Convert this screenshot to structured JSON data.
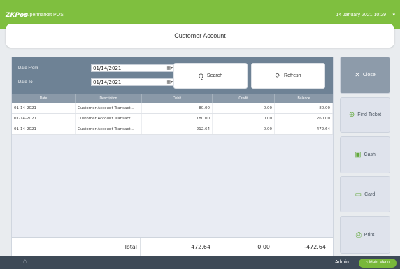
{
  "topbar": {
    "logo": "ZKPos",
    "app_name": "Supermarket POS",
    "datetime": "14 January 2021 10:29",
    "dropdown_glyph": "▾"
  },
  "title": "Customer Account",
  "filters": {
    "date_from_label": "Date From",
    "date_from_value": "01/14/2021",
    "date_to_label": "Date To",
    "date_to_value": "01/14/2021",
    "calendar_glyph": "▦▾"
  },
  "buttons": {
    "search": "Search",
    "search_icon": "Q",
    "refresh": "Refresh",
    "refresh_icon": "⟳"
  },
  "table": {
    "headers": [
      "Date",
      "Description",
      "Debit",
      "Credit",
      "Balance"
    ],
    "rows": [
      [
        "01-14-2021",
        "Customer Account Transact...",
        "80.00",
        "0.00",
        "80.00"
      ],
      [
        "01-14-2021",
        "Customer Account Transact...",
        "180.00",
        "0.00",
        "260.00"
      ],
      [
        "01-14-2021",
        "Customer Account Transact...",
        "212.64",
        "0.00",
        "472.64"
      ]
    ]
  },
  "totals": {
    "label": "Total",
    "debit": "472.64",
    "credit": "0.00",
    "balance": "-472.64"
  },
  "side": {
    "close": "Close",
    "close_icon": "✕",
    "find_ticket": "Find Ticket",
    "find_ticket_icon": "⊕",
    "cash": "Cash",
    "cash_icon": "▣",
    "card": "Card",
    "card_icon": "▭",
    "print": "Print",
    "print_icon": "⎙"
  },
  "bottom": {
    "home_icon": "⌂",
    "user": "Admin",
    "main_menu": "Main Menu",
    "main_menu_icon": "⌂"
  },
  "colors": {
    "topbar": "#7fbf3f",
    "filters_bg": "#6e8295",
    "header_bg": "#8a99a8",
    "bottombar": "#3e4a57",
    "accent_green": "#78b83a"
  }
}
